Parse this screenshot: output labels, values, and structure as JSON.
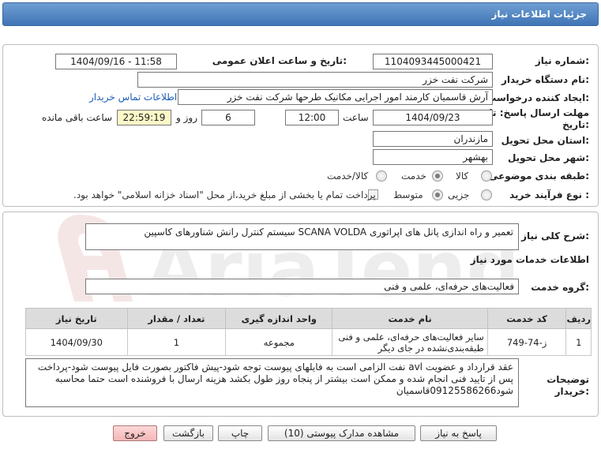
{
  "header": {
    "title": "جزئیات اطلاعات نیاز"
  },
  "fields": {
    "need_number": {
      "label": "شماره نیاز:",
      "value": "1104093445000421"
    },
    "announce": {
      "label": "تاریخ و ساعت اعلان عمومی:",
      "value": "1404/09/16 - 11:58"
    },
    "buyer": {
      "label": "نام دستگاه خریدار:",
      "value": "شرکت نفت خزر"
    },
    "creator": {
      "label": "ایجاد کننده درخواست:",
      "value": "آرش قاسمیان کارمند امور اجرایی مکانیک طرحها شرکت نفت خزر",
      "contact_link": "اطلاعات تماس خریدار"
    },
    "deadline": {
      "label_line1": "مهلت ارسال پاسخ: تا",
      "label_line2": "تاریخ:",
      "date": "1404/09/23",
      "time_label": "ساعت",
      "time": "12:00",
      "days": "6",
      "days_label": "روز و",
      "remaining": "22:59:19",
      "remaining_label": "ساعت باقی مانده"
    },
    "province": {
      "label": "استان محل تحویل:",
      "value": "مازندران"
    },
    "city": {
      "label": "شهر محل تحویل:",
      "value": "بهشهر"
    },
    "category": {
      "label": "طبقه بندی موضوعی:",
      "options": [
        "کالا",
        "خدمت",
        "کالا/خدمت"
      ],
      "selected": "خدمت"
    },
    "process": {
      "label": "نوع فرآیند خرید :",
      "options": [
        "جزیی",
        "متوسط"
      ],
      "selected": "متوسط",
      "checkbox_label": "پرداخت تمام یا بخشی از مبلغ خرید،از محل \"اسناد خزانه اسلامی\" خواهد بود."
    }
  },
  "summary": {
    "label": "شرح کلی نیاز:",
    "value": "تعمیر و راه اندازی پانل های اپراتوری SCANA VOLDA سیستم کنترل رانش شناورهای کاسپین"
  },
  "services_section": {
    "title": "اطلاعات خدمات مورد نیاز"
  },
  "service_group": {
    "label": "گروه خدمت:",
    "value": "فعالیت‌های حرفه‌ای، علمی و فنی"
  },
  "table": {
    "headers": [
      "ردیف",
      "کد خدمت",
      "نام خدمت",
      "واحد اندازه گیری",
      "تعداد / مقدار",
      "تاریخ نیاز"
    ],
    "rows": [
      [
        "1",
        "ز-74-749",
        "سایر فعالیت‌های حرفه‌ای، علمی و فنی طبقه‌بندی‌نشده در جای دیگر",
        "مجموعه",
        "1",
        "1404/09/30"
      ]
    ]
  },
  "buyer_notes": {
    "label_line1": "توضیحات",
    "label_line2": "خریدار:",
    "value": "عقد قرارداد و عضویت avl نفت الزامی است به فایلهای پیوست توجه شود-پیش فاکتور بصورت فایل پیوست شود-پرداخت پس از تایید فنی انجام شده و ممکن است بیشتر از پنجاه روز طول بکشد هزینه ارسال با فروشنده است حتما محاسبه شود09125586266قاسمیان"
  },
  "buttons": {
    "respond": "پاسخ به نیاز",
    "view_docs": "مشاهده مدارک پیوستی (10)",
    "print": "چاپ",
    "back": "بازگشت",
    "exit": "خروج"
  },
  "watermark": {
    "text": "AriaTender.net"
  },
  "colors": {
    "header": "#4a7fbf",
    "exit_button": "#f3b6b6",
    "link": "#1d5db8",
    "remaining_bg": "#fdf8c8"
  }
}
